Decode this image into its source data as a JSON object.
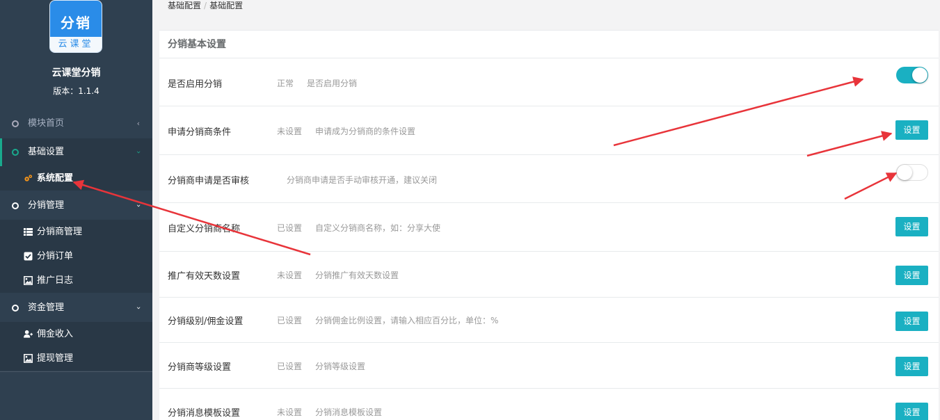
{
  "sidebar": {
    "logo_top": "分销",
    "logo_bottom": "云课堂",
    "app_name": "云课堂分销",
    "version": "版本：1.1.4",
    "nav": [
      {
        "label": "模块首页",
        "caret": "‹"
      },
      {
        "label": "基础设置",
        "caret": "›"
      },
      {
        "label": "分销管理",
        "caret": "›"
      },
      {
        "label": "资金管理",
        "caret": "›"
      }
    ],
    "sub_basic": [
      {
        "label": "系统配置",
        "icon": "gears-icon"
      }
    ],
    "sub_dist": [
      {
        "label": "分销商管理",
        "icon": "list-icon"
      },
      {
        "label": "分销订单",
        "icon": "checkbox-icon"
      },
      {
        "label": "推广日志",
        "icon": "image-icon"
      }
    ],
    "sub_funds": [
      {
        "label": "佣金收入",
        "icon": "user-plus-icon"
      },
      {
        "label": "提现管理",
        "icon": "image-icon"
      }
    ]
  },
  "breadcrumb": [
    "基础配置",
    "基础配置"
  ],
  "panel": {
    "title": "分销基本设置",
    "rows": [
      {
        "name": "是否启用分销",
        "status": "正常",
        "desc": "是否启用分销",
        "control": "toggle",
        "on": true
      },
      {
        "name": "申请分销商条件",
        "status": "未设置",
        "desc": "申请成为分销商的条件设置",
        "control": "button",
        "button_label": "设置"
      },
      {
        "name": "分销商申请是否审核",
        "status": "",
        "desc": "分销商申请是否手动审核开通，建议关闭",
        "control": "toggle",
        "on": false
      },
      {
        "name": "自定义分销商名称",
        "status": "已设置",
        "desc": "自定义分销商名称，如：分享大使",
        "control": "button",
        "button_label": "设置"
      },
      {
        "name": "推广有效天数设置",
        "status": "未设置",
        "desc": "分销推广有效天数设置",
        "control": "button",
        "button_label": "设置"
      },
      {
        "name": "分销级别/佣金设置",
        "status": "已设置",
        "desc": "分销佣金比例设置，请输入相应百分比，单位：%",
        "control": "button",
        "button_label": "设置"
      },
      {
        "name": "分销商等级设置",
        "status": "已设置",
        "desc": "分销等级设置",
        "control": "button",
        "button_label": "设置"
      },
      {
        "name": "分销消息模板设置",
        "status": "未设置",
        "desc": "分销消息模板设置",
        "control": "button",
        "button_label": "设置"
      }
    ]
  },
  "colors": {
    "accent": "#1ab0c2",
    "sidebar": "#2f4050",
    "annotation": "#e8343a"
  }
}
